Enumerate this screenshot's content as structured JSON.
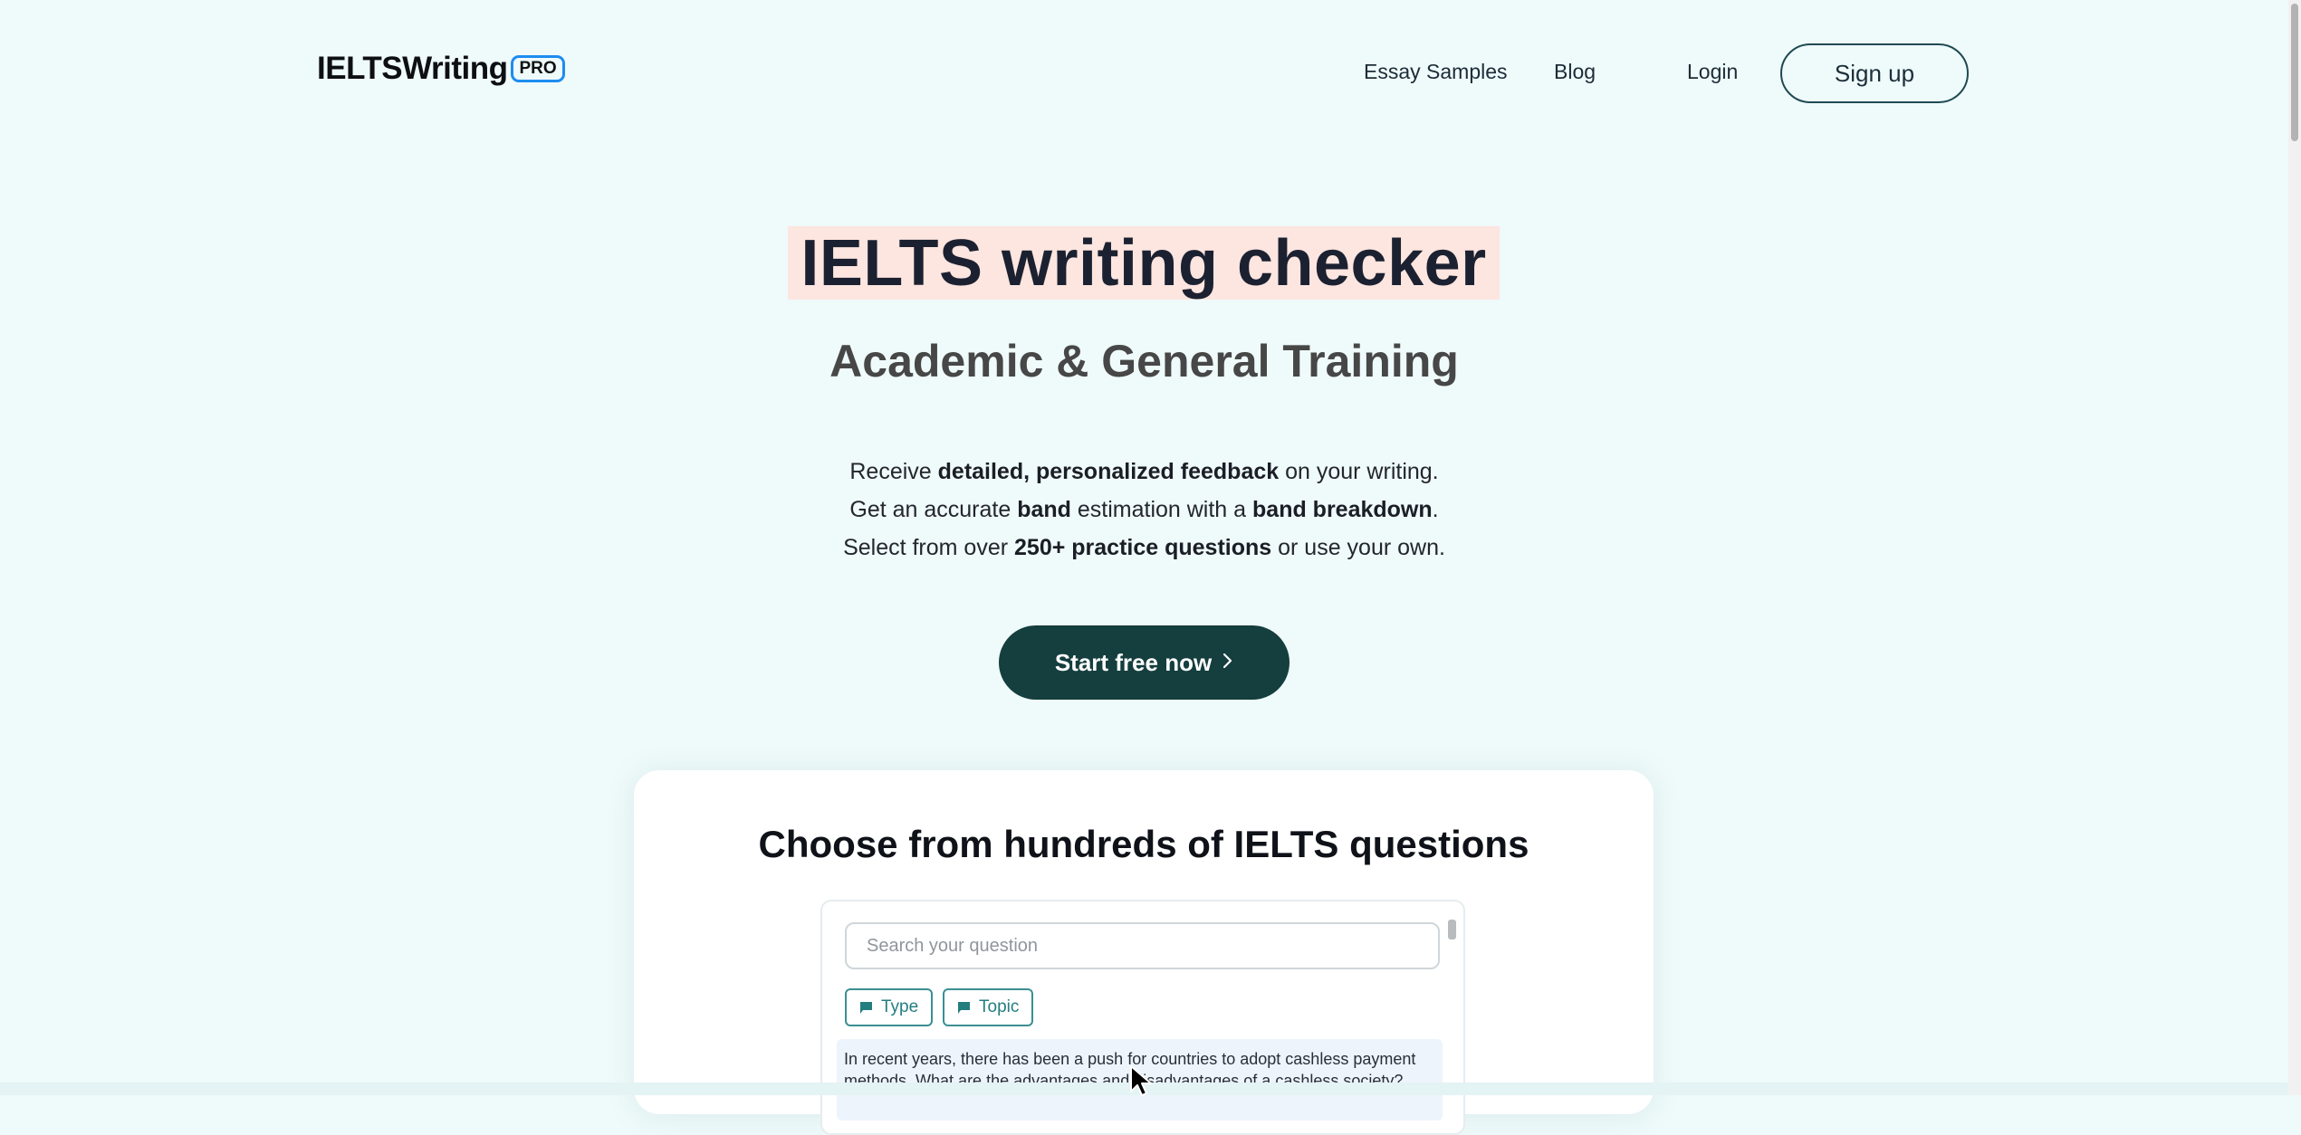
{
  "nav": {
    "logo_text": "IELTSWriting",
    "logo_badge": "PRO",
    "essay_samples": "Essay Samples",
    "blog": "Blog",
    "login": "Login",
    "signup": "Sign up"
  },
  "hero": {
    "title": "IELTS writing checker",
    "subtitle": "Academic & General Training",
    "line1": {
      "a": "Receive ",
      "b": "detailed, personalized feedback",
      "c": " on your writing."
    },
    "line2": {
      "a": "Get an accurate ",
      "b": "band",
      "c": " estimation with a ",
      "d": "band breakdown",
      "e": "."
    },
    "line3": {
      "a": "Select from over ",
      "b": "250+ practice questions",
      "c": " or use your own."
    },
    "cta": "Start free now",
    "cta_icon": "chevron-right-icon"
  },
  "questions_card": {
    "title": "Choose from hundreds of IELTS questions",
    "search_placeholder": "Search your question",
    "filter_type": "Type",
    "filter_topic": "Topic",
    "filter_icon": "flag-icon",
    "first_question": "In recent years, there has been a push for countries to adopt cashless payment methods. What are the advantages and disadvantages of a cashless society?"
  },
  "colors": {
    "page_background": "#effafa",
    "title_highlight": "#fde5e0",
    "cta_background": "#153e3e",
    "accent_teal": "#237e80",
    "logo_badge_border": "#1d8cf0"
  }
}
